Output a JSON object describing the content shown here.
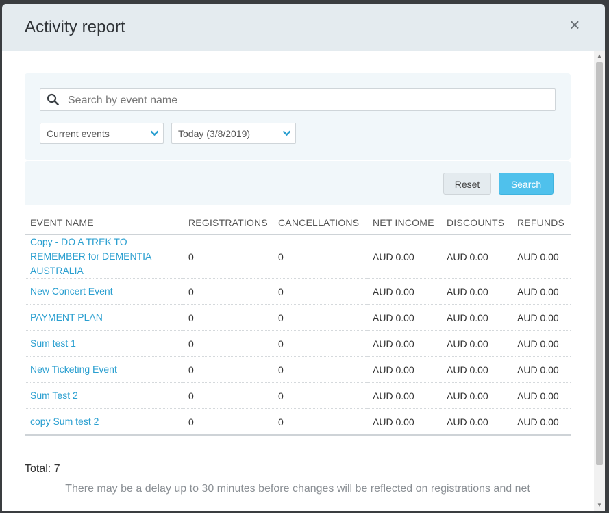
{
  "modal": {
    "title": "Activity report",
    "close_label": "×"
  },
  "search": {
    "placeholder": "Search by event name",
    "value": ""
  },
  "filters": {
    "event_scope": "Current events",
    "date_range": "Today (3/8/2019)"
  },
  "actions": {
    "reset_label": "Reset",
    "search_label": "Search"
  },
  "table": {
    "headers": [
      "EVENT NAME",
      "REGISTRATIONS",
      "CANCELLATIONS",
      "NET INCOME",
      "DISCOUNTS",
      "REFUNDS"
    ],
    "rows": [
      {
        "event": "Copy - DO A TREK TO REMEMBER for DEMENTIA AUSTRALIA",
        "registrations": "0",
        "cancellations": "0",
        "net_income": "AUD 0.00",
        "discounts": "AUD 0.00",
        "refunds": "AUD 0.00"
      },
      {
        "event": "New Concert Event",
        "registrations": "0",
        "cancellations": "0",
        "net_income": "AUD 0.00",
        "discounts": "AUD 0.00",
        "refunds": "AUD 0.00"
      },
      {
        "event": "PAYMENT PLAN",
        "registrations": "0",
        "cancellations": "0",
        "net_income": "AUD 0.00",
        "discounts": "AUD 0.00",
        "refunds": "AUD 0.00"
      },
      {
        "event": "Sum test 1",
        "registrations": "0",
        "cancellations": "0",
        "net_income": "AUD 0.00",
        "discounts": "AUD 0.00",
        "refunds": "AUD 0.00"
      },
      {
        "event": "New Ticketing Event",
        "registrations": "0",
        "cancellations": "0",
        "net_income": "AUD 0.00",
        "discounts": "AUD 0.00",
        "refunds": "AUD 0.00"
      },
      {
        "event": "Sum Test 2",
        "registrations": "0",
        "cancellations": "0",
        "net_income": "AUD 0.00",
        "discounts": "AUD 0.00",
        "refunds": "AUD 0.00"
      },
      {
        "event": "copy Sum test 2",
        "registrations": "0",
        "cancellations": "0",
        "net_income": "AUD 0.00",
        "discounts": "AUD 0.00",
        "refunds": "AUD 0.00"
      }
    ]
  },
  "summary": {
    "total": "Total: 7",
    "note": "There may be a delay up to 30 minutes before changes will be reflected on registrations and net"
  },
  "colors": {
    "accent": "#4fc1ec",
    "link": "#2a9fd0",
    "header_bg": "#e4ebef",
    "panel_bg": "#f1f7fa"
  }
}
